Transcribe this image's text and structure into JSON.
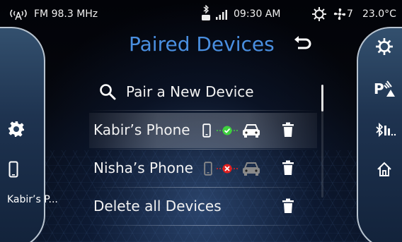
{
  "status_bar": {
    "radio_icon": "antenna-icon",
    "radio_station": "FM 98.3 MHz",
    "bluetooth_icon": "bluetooth-phone-icon",
    "signal_icon": "signal-bars-icon",
    "time": "09:30 AM",
    "climate_icon": "ac-icon",
    "fan_icon": "fan-icon",
    "fan_speed": "7",
    "temperature": "23.0°C"
  },
  "left_panel": {
    "settings_icon": "gear-icon",
    "phone_icon": "phone-icon",
    "connected_phone": "Kabir’s P..."
  },
  "right_panel": {
    "items": [
      "climate-icon",
      "parking-assist-icon",
      "bluetooth-audio-icon",
      "home-icon"
    ]
  },
  "main": {
    "title": "Paired Devices",
    "back_icon": "back-arrow-icon",
    "pair_new_label": "Pair a New Device",
    "devices": [
      {
        "name": "Kabir’s Phone",
        "status": "connected",
        "status_color": "#3fd13f"
      },
      {
        "name": "Nisha’s Phone",
        "status": "disconnected",
        "status_color": "#e02020"
      }
    ],
    "delete_all_label": "Delete all Devices"
  },
  "colors": {
    "accent": "#4a8fe0",
    "connected": "#3fd13f",
    "disconnected": "#e02020"
  }
}
